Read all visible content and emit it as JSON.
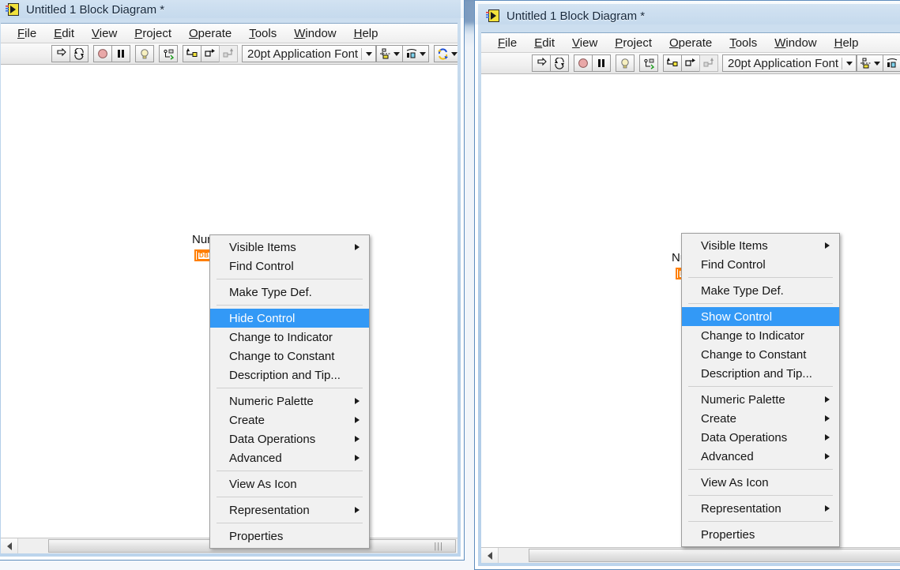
{
  "app": {
    "title": "Untitled 1 Block Diagram *",
    "icon": "labview-block-diagram-icon"
  },
  "menubar": {
    "items": [
      {
        "label": "File",
        "accel": "F"
      },
      {
        "label": "Edit",
        "accel": "E"
      },
      {
        "label": "View",
        "accel": "V"
      },
      {
        "label": "Project",
        "accel": "P"
      },
      {
        "label": "Operate",
        "accel": "O"
      },
      {
        "label": "Tools",
        "accel": "T"
      },
      {
        "label": "Window",
        "accel": "W"
      },
      {
        "label": "Help",
        "accel": "H"
      }
    ]
  },
  "toolbar": {
    "font_selector_value": "20pt Application Font",
    "buttons": [
      {
        "name": "run-button",
        "glyph": "run-arrow-icon"
      },
      {
        "name": "run-continuously-button",
        "glyph": "run-continuously-icon"
      },
      {
        "name": "abort-execution-button",
        "glyph": "abort-stop-icon"
      },
      {
        "name": "pause-button",
        "glyph": "pause-icon"
      },
      {
        "name": "highlight-execution-button",
        "glyph": "light-bulb-icon"
      },
      {
        "name": "retain-wire-values-button",
        "glyph": "retain-wire-values-icon"
      },
      {
        "name": "step-into-button",
        "glyph": "step-into-icon"
      },
      {
        "name": "step-over-button",
        "glyph": "step-over-icon"
      },
      {
        "name": "step-out-button",
        "glyph": "step-out-icon"
      },
      {
        "name": "align-objects-button",
        "glyph": "align-objects-icon"
      },
      {
        "name": "distribute-objects-button",
        "glyph": "distribute-objects-icon"
      },
      {
        "name": "reorder-button",
        "glyph": "reorder-icon"
      },
      {
        "name": "clean-up-diagram-button",
        "glyph": "clean-up-diagram-icon"
      }
    ]
  },
  "canvas": {
    "terminal_label": "Numeric",
    "terminal_type": "DBL",
    "terminal_color": "#ff7f00"
  },
  "context_menu": {
    "highlight_color": "#3399f6",
    "left": {
      "items": [
        {
          "label": "Visible Items",
          "submenu": true,
          "selected": false,
          "sep_after": false
        },
        {
          "label": "Find Control",
          "submenu": false,
          "selected": false,
          "sep_after": true
        },
        {
          "label": "Make Type Def.",
          "submenu": false,
          "selected": false,
          "sep_after": true
        },
        {
          "label": "Hide Control",
          "submenu": false,
          "selected": true,
          "sep_after": false
        },
        {
          "label": "Change to Indicator",
          "submenu": false,
          "selected": false,
          "sep_after": false
        },
        {
          "label": "Change to Constant",
          "submenu": false,
          "selected": false,
          "sep_after": false
        },
        {
          "label": "Description and Tip...",
          "submenu": false,
          "selected": false,
          "sep_after": true
        },
        {
          "label": "Numeric Palette",
          "submenu": true,
          "selected": false,
          "sep_after": false
        },
        {
          "label": "Create",
          "submenu": true,
          "selected": false,
          "sep_after": false
        },
        {
          "label": "Data Operations",
          "submenu": true,
          "selected": false,
          "sep_after": false
        },
        {
          "label": "Advanced",
          "submenu": true,
          "selected": false,
          "sep_after": true
        },
        {
          "label": "View As Icon",
          "submenu": false,
          "selected": false,
          "sep_after": true
        },
        {
          "label": "Representation",
          "submenu": true,
          "selected": false,
          "sep_after": true
        },
        {
          "label": "Properties",
          "submenu": false,
          "selected": false,
          "sep_after": false
        }
      ]
    },
    "right": {
      "items": [
        {
          "label": "Visible Items",
          "submenu": true,
          "selected": false,
          "sep_after": false
        },
        {
          "label": "Find Control",
          "submenu": false,
          "selected": false,
          "sep_after": true
        },
        {
          "label": "Make Type Def.",
          "submenu": false,
          "selected": false,
          "sep_after": true
        },
        {
          "label": "Show Control",
          "submenu": false,
          "selected": true,
          "sep_after": false
        },
        {
          "label": "Change to Indicator",
          "submenu": false,
          "selected": false,
          "sep_after": false
        },
        {
          "label": "Change to Constant",
          "submenu": false,
          "selected": false,
          "sep_after": false
        },
        {
          "label": "Description and Tip...",
          "submenu": false,
          "selected": false,
          "sep_after": true
        },
        {
          "label": "Numeric Palette",
          "submenu": true,
          "selected": false,
          "sep_after": false
        },
        {
          "label": "Create",
          "submenu": true,
          "selected": false,
          "sep_after": false
        },
        {
          "label": "Data Operations",
          "submenu": true,
          "selected": false,
          "sep_after": false
        },
        {
          "label": "Advanced",
          "submenu": true,
          "selected": false,
          "sep_after": true
        },
        {
          "label": "View As Icon",
          "submenu": false,
          "selected": false,
          "sep_after": true
        },
        {
          "label": "Representation",
          "submenu": true,
          "selected": false,
          "sep_after": true
        },
        {
          "label": "Properties",
          "submenu": false,
          "selected": false,
          "sep_after": false
        }
      ]
    }
  }
}
